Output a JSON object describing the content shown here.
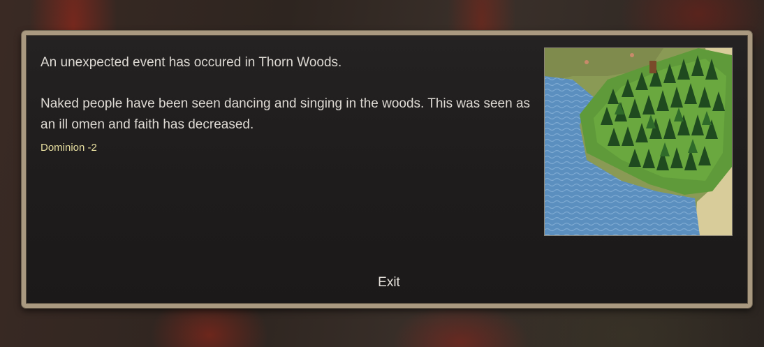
{
  "event": {
    "intro": "An unexpected event has occured in Thorn Woods.",
    "description": "Naked people have been seen dancing and singing in the woods. This was seen as an ill omen and faith has decreased.",
    "effect": "Dominion -2",
    "exit_label": "Exit"
  },
  "colors": {
    "effect_text": "#e8dfa0",
    "panel_border": "#a99980",
    "panel_background": "#1e1c1c"
  }
}
